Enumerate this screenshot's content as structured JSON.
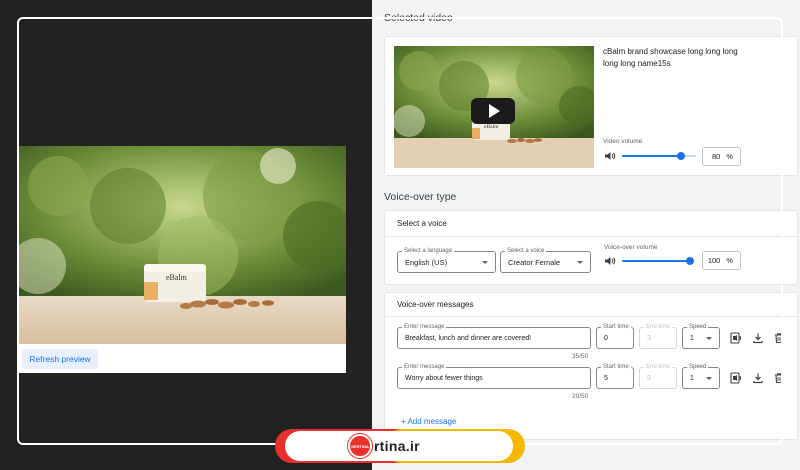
{
  "preview": {
    "refresh_label": "Refresh preview",
    "jar_brand": "eBalm"
  },
  "selected_video": {
    "section_title": "Selected video",
    "name": "cBalm brand showcase long long long long long name15s",
    "thumb_brand": "eBalm",
    "volume_label": "Video volume",
    "volume_value": "80",
    "volume_unit": "%",
    "volume_level": 0.8
  },
  "voice_over": {
    "section_title": "Voice-over type",
    "card_title": "Select a voice",
    "language": {
      "label": "Select a language",
      "value": "English (US)"
    },
    "voice": {
      "label": "Select a voice",
      "value": "Creator Female"
    },
    "volume_label": "Voice-over volume",
    "volume_value": "100",
    "volume_unit": "%",
    "volume_level": 1.0
  },
  "messages": {
    "card_title": "Voice-over messages",
    "rows": [
      {
        "message_label": "Enter message",
        "message": "Breakfast, lunch and dinner are covered!",
        "counter": "35/50",
        "start_label": "Start time",
        "start": "0",
        "end_label": "End time",
        "end": "3",
        "speed_label": "Speed",
        "speed": "1"
      },
      {
        "message_label": "Enter message",
        "message": "Worry about fewer things",
        "counter": "20/50",
        "start_label": "Start time",
        "start": "5",
        "end_label": "End time",
        "end": "9",
        "speed_label": "Speed",
        "speed": "1"
      }
    ],
    "add_label": "+ Add message"
  },
  "watermark": {
    "text": "bertina.ir",
    "badge_text": "BERTINA"
  },
  "colors": {
    "accent": "#1a73e8",
    "panel_bg": "#f1f3f4",
    "dark_bg": "#232223",
    "watermark_red": "#e8312c",
    "watermark_yellow": "#f5b800"
  }
}
